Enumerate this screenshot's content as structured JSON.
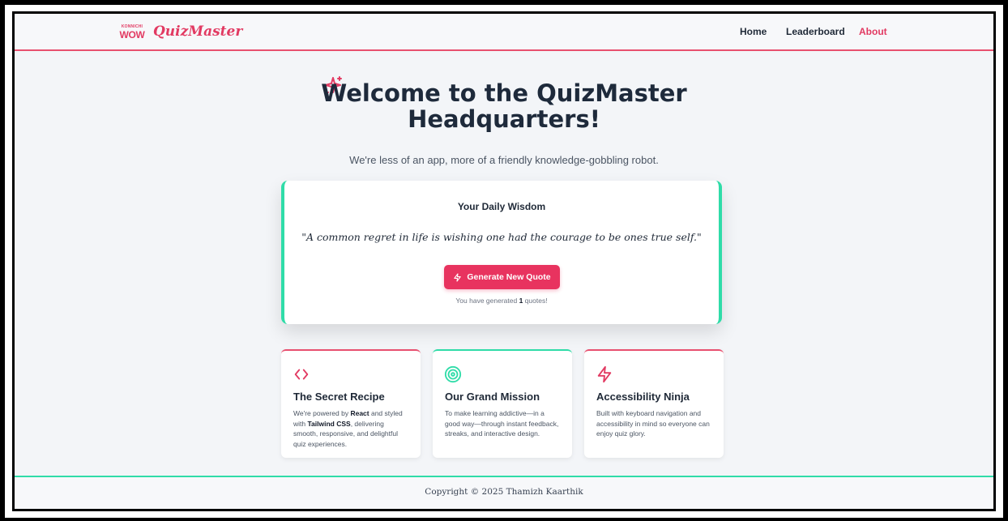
{
  "brand": {
    "badge_small": "KONNICHI",
    "badge_big": "WOW",
    "name": "QuizMaster",
    "color": "#e23a62"
  },
  "nav": {
    "items": [
      {
        "label": "Home",
        "active": false
      },
      {
        "label": "Leaderboard",
        "active": false
      },
      {
        "label": "About",
        "active": true
      }
    ]
  },
  "hero": {
    "icon": "sparkles-icon",
    "title_line1": "Welcome to the QuizMaster",
    "title_line2": "Headquarters!",
    "subtitle": "We're less of an app, more of a friendly knowledge-gobbling robot."
  },
  "quote_card": {
    "heading": "Your Daily Wisdom",
    "quote": "\"A common regret in life is wishing one had the courage to be ones true self.\"",
    "button_label": "Generate New Quote",
    "button_icon": "zap-icon",
    "count_prefix": "You have generated ",
    "count_value": "1",
    "count_suffix": " quotes!",
    "accent": "#2fdca8"
  },
  "features": [
    {
      "icon": "code-icon",
      "title": "The Secret Recipe",
      "desc_1": "We're powered by ",
      "desc_bold_1": "React",
      "desc_2": " and styled with ",
      "desc_bold_2": "Tailwind CSS",
      "desc_3": ", delivering smooth, responsive, and delightful quiz experiences."
    },
    {
      "icon": "target-icon",
      "title": "Our Grand Mission",
      "desc": "To make learning addictive—in a good way—through instant feedback, streaks, and interactive design."
    },
    {
      "icon": "zap-icon",
      "title": "Accessibility Ninja",
      "desc": "Built with keyboard navigation and accessibility in mind so everyone can enjoy quiz glory."
    }
  ],
  "footer": {
    "copyright": "Copyright © 2025 Thamizh Kaarthik"
  },
  "colors": {
    "accent_pink": "#e8335f",
    "accent_teal": "#2fdca8",
    "text_dark": "#1e2a3b"
  }
}
